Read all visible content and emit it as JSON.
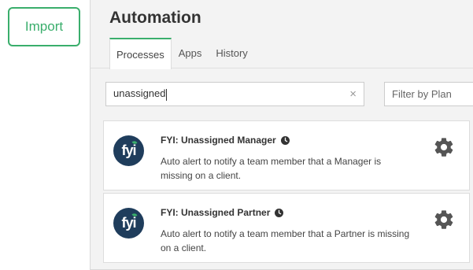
{
  "import_label": "Import",
  "header": {
    "title": "Automation"
  },
  "tabs": [
    {
      "label": "Processes"
    },
    {
      "label": "Apps"
    },
    {
      "label": "History"
    }
  ],
  "search": {
    "value": "unassigned",
    "clear_icon": "×"
  },
  "filter": {
    "placeholder": "Filter by Plan"
  },
  "processes": [
    {
      "logo_text": "fyi",
      "title": "FYI: Unassigned Manager",
      "description": "Auto alert to notify a team member that a Manager is missing on a client."
    },
    {
      "logo_text": "fyi",
      "title": "FYI: Unassigned Partner",
      "description": "Auto alert to notify a team member that a Partner is missing on a client."
    }
  ],
  "colors": {
    "accent": "#3aae6c",
    "logo_bg": "#1f3d5c",
    "gear": "#555555"
  }
}
